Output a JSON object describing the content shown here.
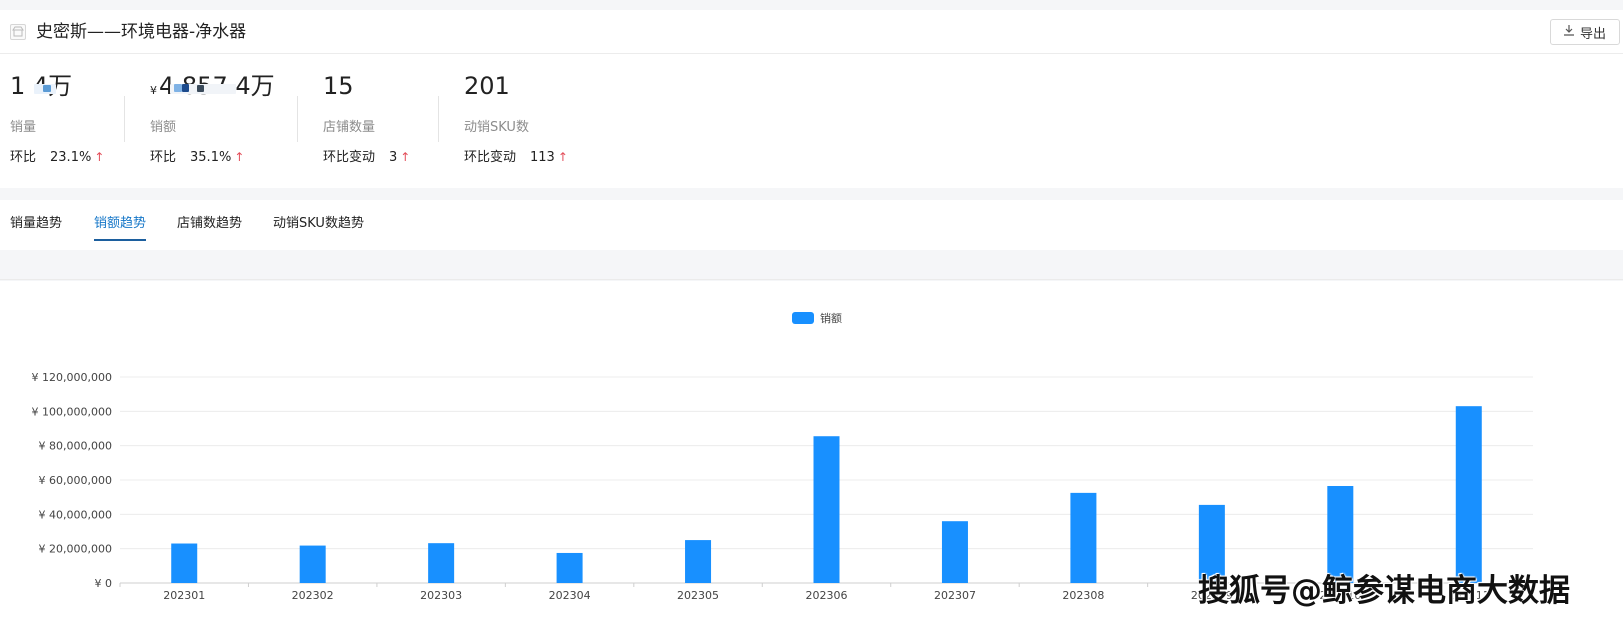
{
  "header": {
    "title": "史密斯——环境电器-净水器",
    "export_label": "导出",
    "shop_icon": "shop-icon",
    "download_icon": "download-icon"
  },
  "stats": [
    {
      "value": "1  4万",
      "currency": "",
      "label": "销量",
      "change_label": "环比",
      "change_value": "23.1%",
      "trend": "up"
    },
    {
      "value": "4  857.4万",
      "currency": "¥",
      "label": "销额",
      "change_label": "环比",
      "change_value": "35.1%",
      "trend": "up"
    },
    {
      "value": "15",
      "currency": "",
      "label": "店铺数量",
      "change_label": "环比变动",
      "change_value": "3",
      "trend": "up"
    },
    {
      "value": "201",
      "currency": "",
      "label": "动销SKU数",
      "change_label": "环比变动",
      "change_value": "113",
      "trend": "up"
    }
  ],
  "trend_arrow": "↑",
  "tabs": [
    {
      "label": "销量趋势",
      "active": false
    },
    {
      "label": "销额趋势",
      "active": true
    },
    {
      "label": "店铺数趋势",
      "active": false
    },
    {
      "label": "动销SKU数趋势",
      "active": false
    }
  ],
  "colors": {
    "bar": "#1890ff",
    "active_tab": "#1677c8",
    "up_arrow": "#e34d59"
  },
  "chart_data": {
    "type": "bar",
    "categories": [
      "202301",
      "202302",
      "202303",
      "202304",
      "202305",
      "202306",
      "202307",
      "202308",
      "202309",
      "202310",
      "202311"
    ],
    "series": [
      {
        "name": "销额",
        "values": [
          23000000,
          21800000,
          23200000,
          17500000,
          25000000,
          85500000,
          36000000,
          52500000,
          45500000,
          56500000,
          103000000
        ]
      }
    ],
    "y_ticks": [
      "¥ 0",
      "¥ 20,000,000",
      "¥ 40,000,000",
      "¥ 60,000,000",
      "¥ 80,000,000",
      "¥ 100,000,000",
      "¥ 120,000,000"
    ],
    "ylim": [
      0,
      120000000
    ],
    "legend": "top-center",
    "grid": true
  },
  "watermark": "搜狐号@鲸参谋电商大数据"
}
